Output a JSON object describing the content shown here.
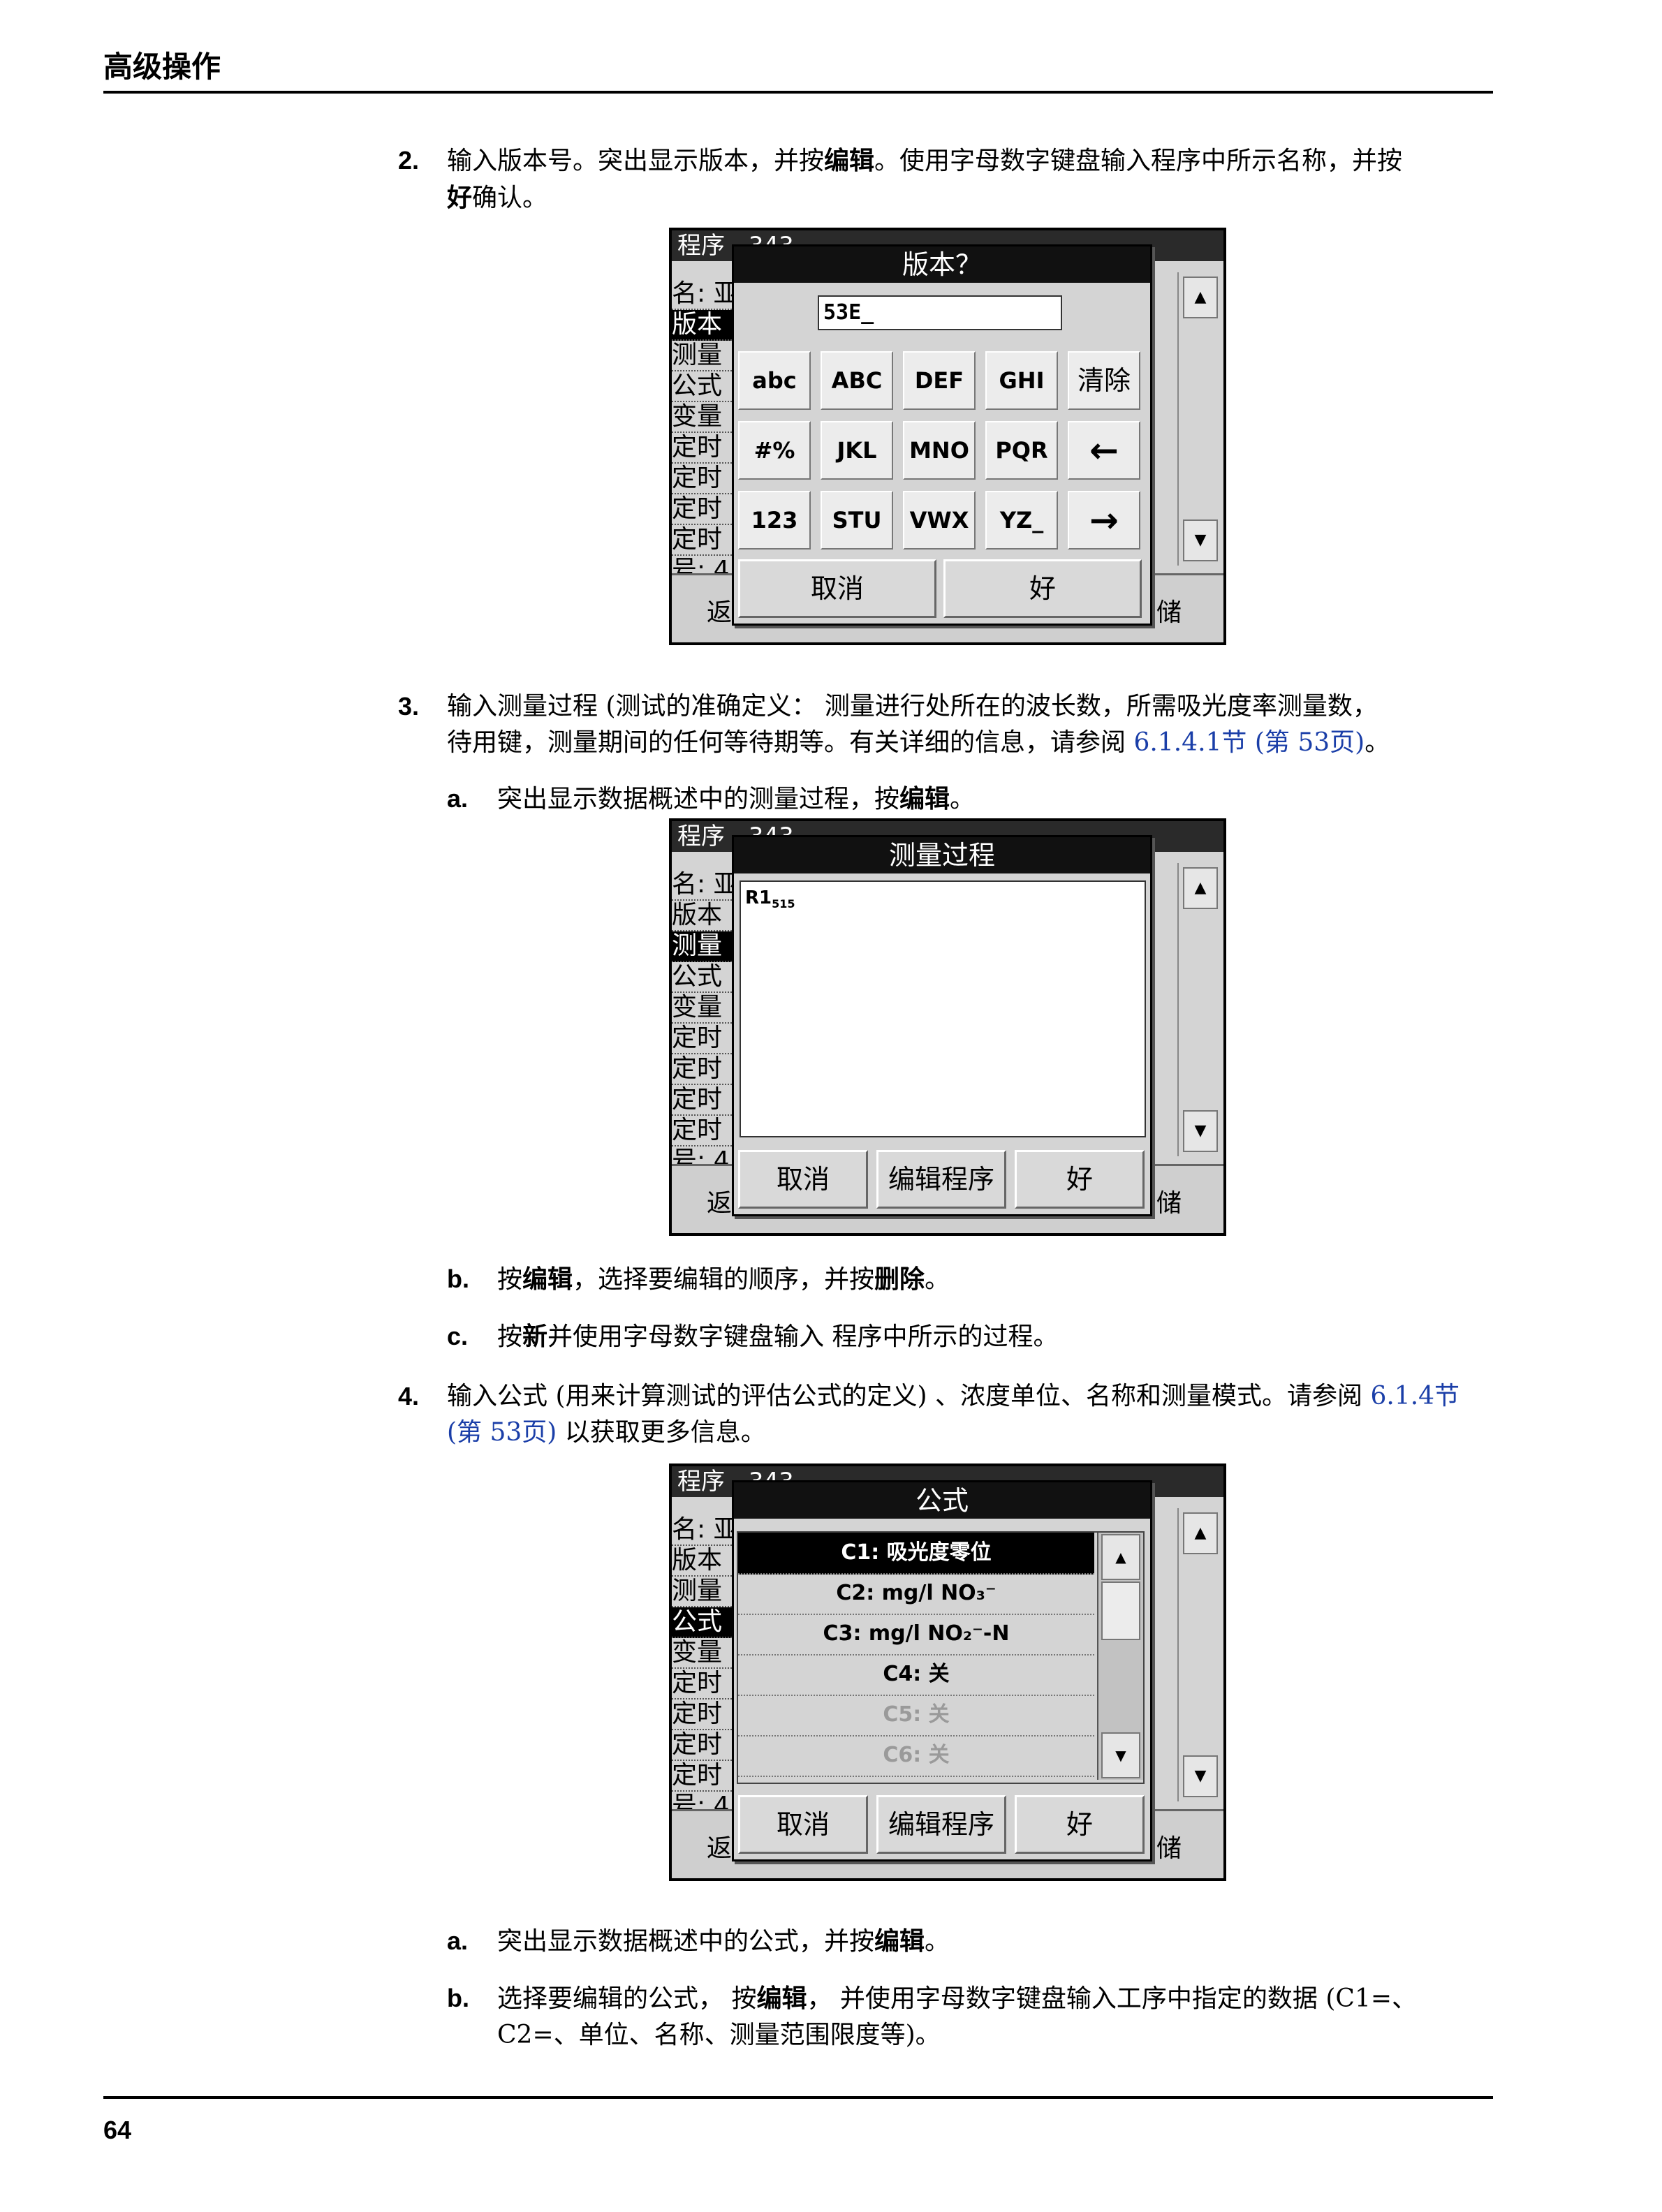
{
  "header": {
    "title": "高级操作"
  },
  "page_number": "64",
  "steps": {
    "s2": {
      "num": "2.",
      "text_line1": "输入版本号。突出显示版本，并按",
      "bold1": "编辑",
      "text_line1b": "。使用字母数字键盘输入程序中所示名称，并按",
      "bold2": "好",
      "text_line2": "确认。"
    },
    "s3": {
      "num": "3.",
      "line1": "输入测量过程 (测试的准确定义： 测量进行处所在的波长数，所需吸光度率测量数，",
      "line2a": "待用键，测量期间的任何等待期等。有关详细的信息，请参阅",
      "link": "6.1.4.1节 (第 53页)",
      "line2b": "。",
      "a_label": "a.",
      "a_text": "突出显示数据概述中的测量过程，按",
      "a_bold": "编辑",
      "a_end": "。",
      "b_label": "b.",
      "b_text1": "按",
      "b_bold1": "编辑",
      "b_text2": "，选择要编辑的顺序，并按",
      "b_bold2": "删除",
      "b_end": "。",
      "c_label": "c.",
      "c_text1": "按",
      "c_bold": "新",
      "c_text2": "并使用字母数字键盘输入 程序中所示的过程。"
    },
    "s4": {
      "num": "4.",
      "line1": "输入公式 (用来计算测试的评估公式的定义) 、浓度单位、名称和测量模式。请参阅",
      "link1": "6.1.4节",
      "link2": "(第 53页)",
      "line2": "以获取更多信息。",
      "a_label": "a.",
      "a_text": "突出显示数据概述中的公式，并按",
      "a_bold": "编辑",
      "a_end": "。",
      "b_label": "b.",
      "b_text1": "选择要编辑的公式， 按",
      "b_bold": "编辑",
      "b_text2": "， 并使用字母数字键盘输入工序中指定的数据 (C1=、",
      "b_line2": "C2=、单位、名称、测量范围限度等)。"
    }
  },
  "screen_bg": {
    "title": "程序 - 343",
    "list": [
      "名: 亚",
      "版本",
      "测量",
      "公式",
      "变量",
      "定时",
      "定时",
      "定时",
      "定时",
      "号: 4"
    ],
    "bottom_left": "返",
    "bottom_right": "储"
  },
  "dialog_version": {
    "title": "版本？",
    "input_value": "53E_",
    "keys": [
      "abc",
      "ABC",
      "DEF",
      "GHI",
      "清除",
      "#%",
      "JKL",
      "MNO",
      "PQR",
      "←",
      "123",
      "STU",
      "VWX",
      "YZ_",
      "→"
    ],
    "cancel": "取消",
    "ok": "好"
  },
  "dialog_measure": {
    "title": "测量过程",
    "content_main": "R1",
    "content_sub": "515",
    "cancel": "取消",
    "edit": "编辑程序",
    "ok": "好"
  },
  "dialog_formula": {
    "title": "公式",
    "rows": [
      "C1: 吸光度零位",
      "C2: mg/l NO₃⁻",
      "C3: mg/l NO₂⁻-N",
      "C4: 关",
      "C5: 关",
      "C6: 关"
    ],
    "cancel": "取消",
    "edit": "编辑程序",
    "ok": "好"
  }
}
